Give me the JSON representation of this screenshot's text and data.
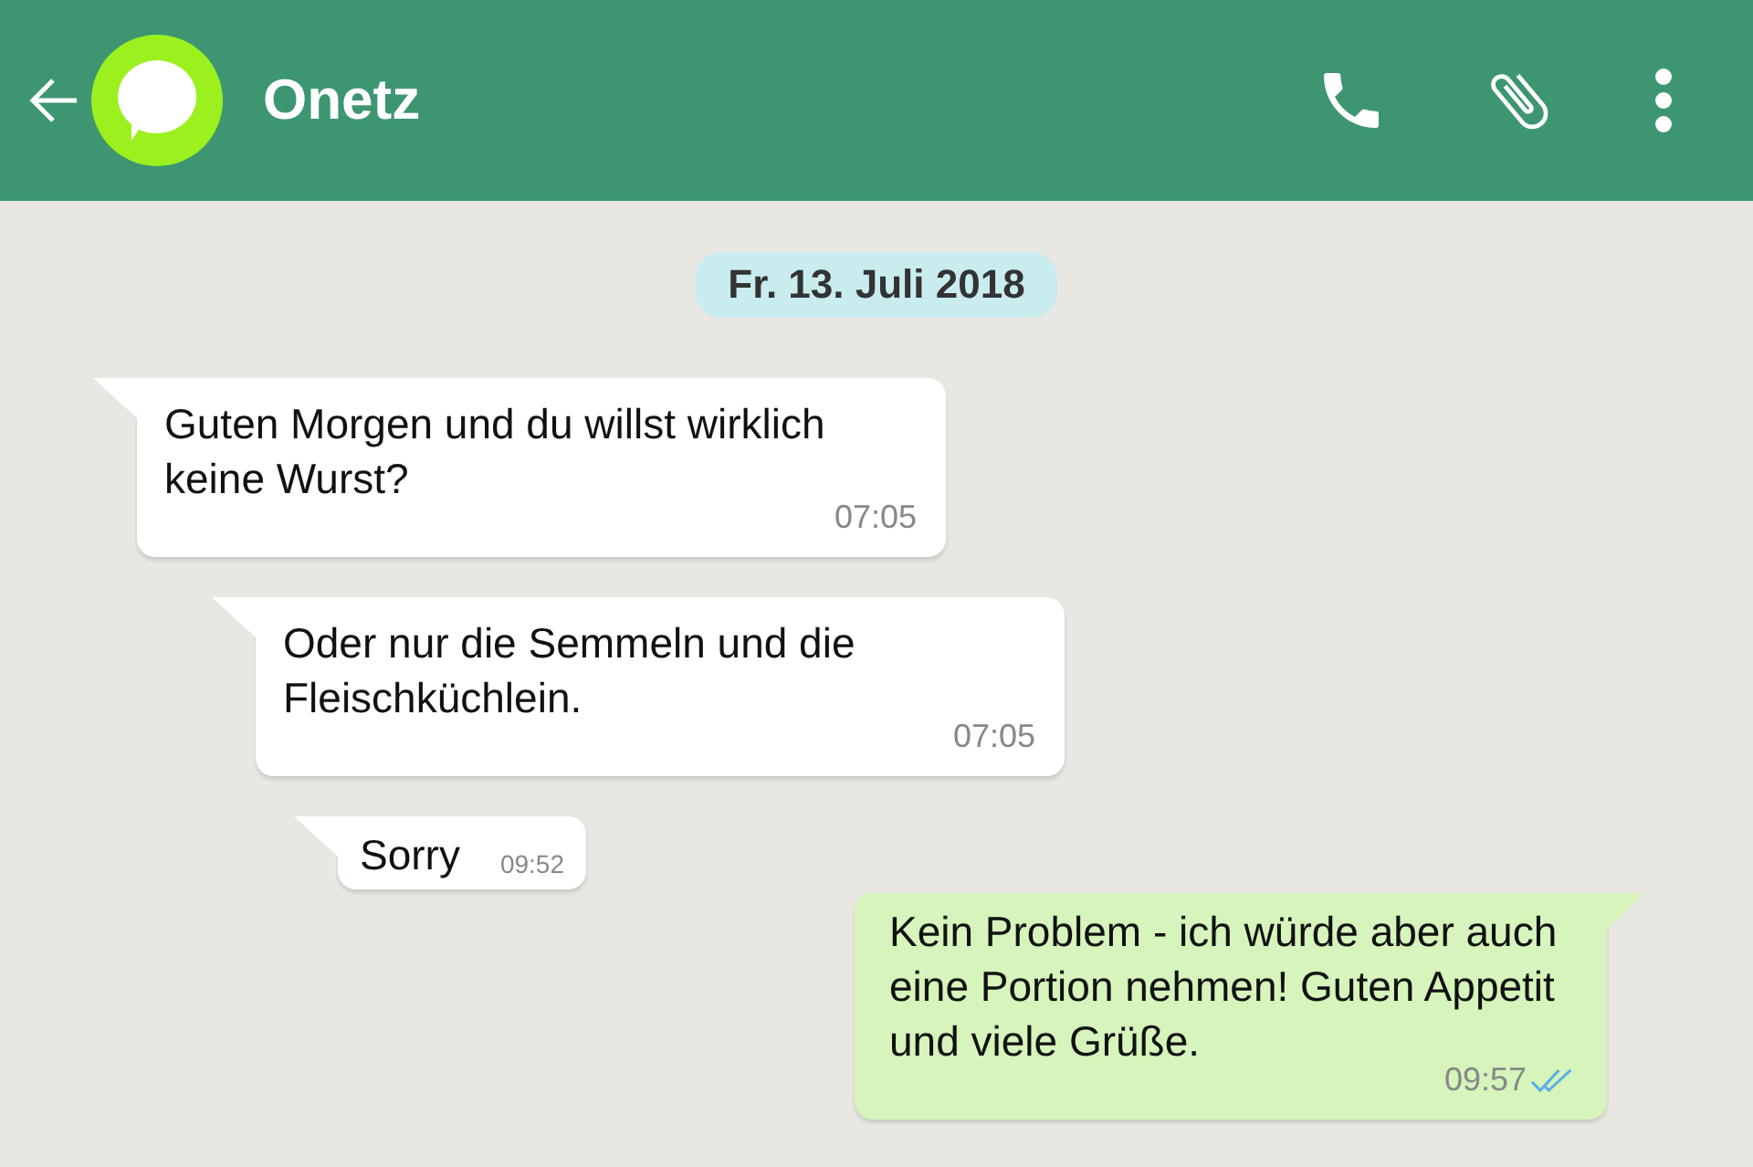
{
  "header": {
    "title": "Onetz"
  },
  "date_label": "Fr. 13. Juli 2018",
  "messages": [
    {
      "kind": "incoming",
      "text": "Guten Morgen und du willst wirklich keine Wurst?",
      "time": "07:05"
    },
    {
      "kind": "incoming",
      "text": "Oder nur die Semmeln und die Fleischküchlein.",
      "time": "07:05"
    },
    {
      "kind": "incoming",
      "text": "Sorry",
      "time": "09:52"
    },
    {
      "kind": "outgoing",
      "text": "Kein Problem - ich würde aber auch eine Portion nehmen! Guten Appetit und viele Grüße.",
      "time": "09:57",
      "read": true
    }
  ]
}
